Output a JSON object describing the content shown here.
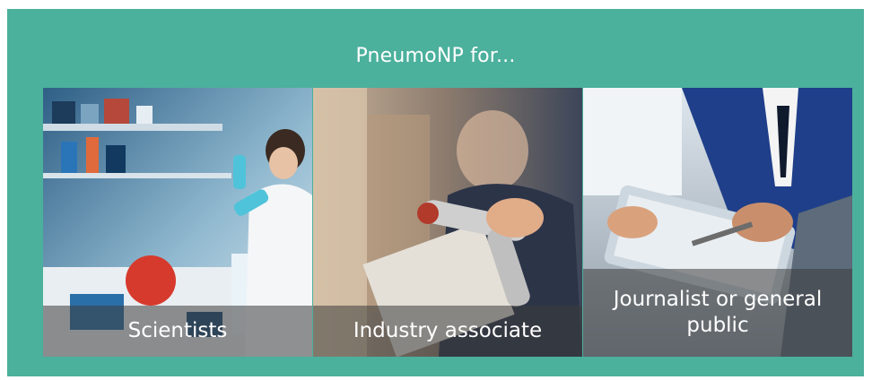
{
  "section": {
    "title": "PneumoNP for..."
  },
  "cards": [
    {
      "label": "Scientists",
      "image_subject": "laboratory-scientist-image"
    },
    {
      "label": "Industry associate",
      "image_subject": "barcode-scanner-worker-image"
    },
    {
      "label": "Journalist or general public",
      "image_subject": "business-tablet-meeting-image"
    }
  ],
  "colors": {
    "panel_background": "#4bb09c",
    "caption_overlay": "rgba(60,60,60,0.55)",
    "text": "#ffffff"
  }
}
